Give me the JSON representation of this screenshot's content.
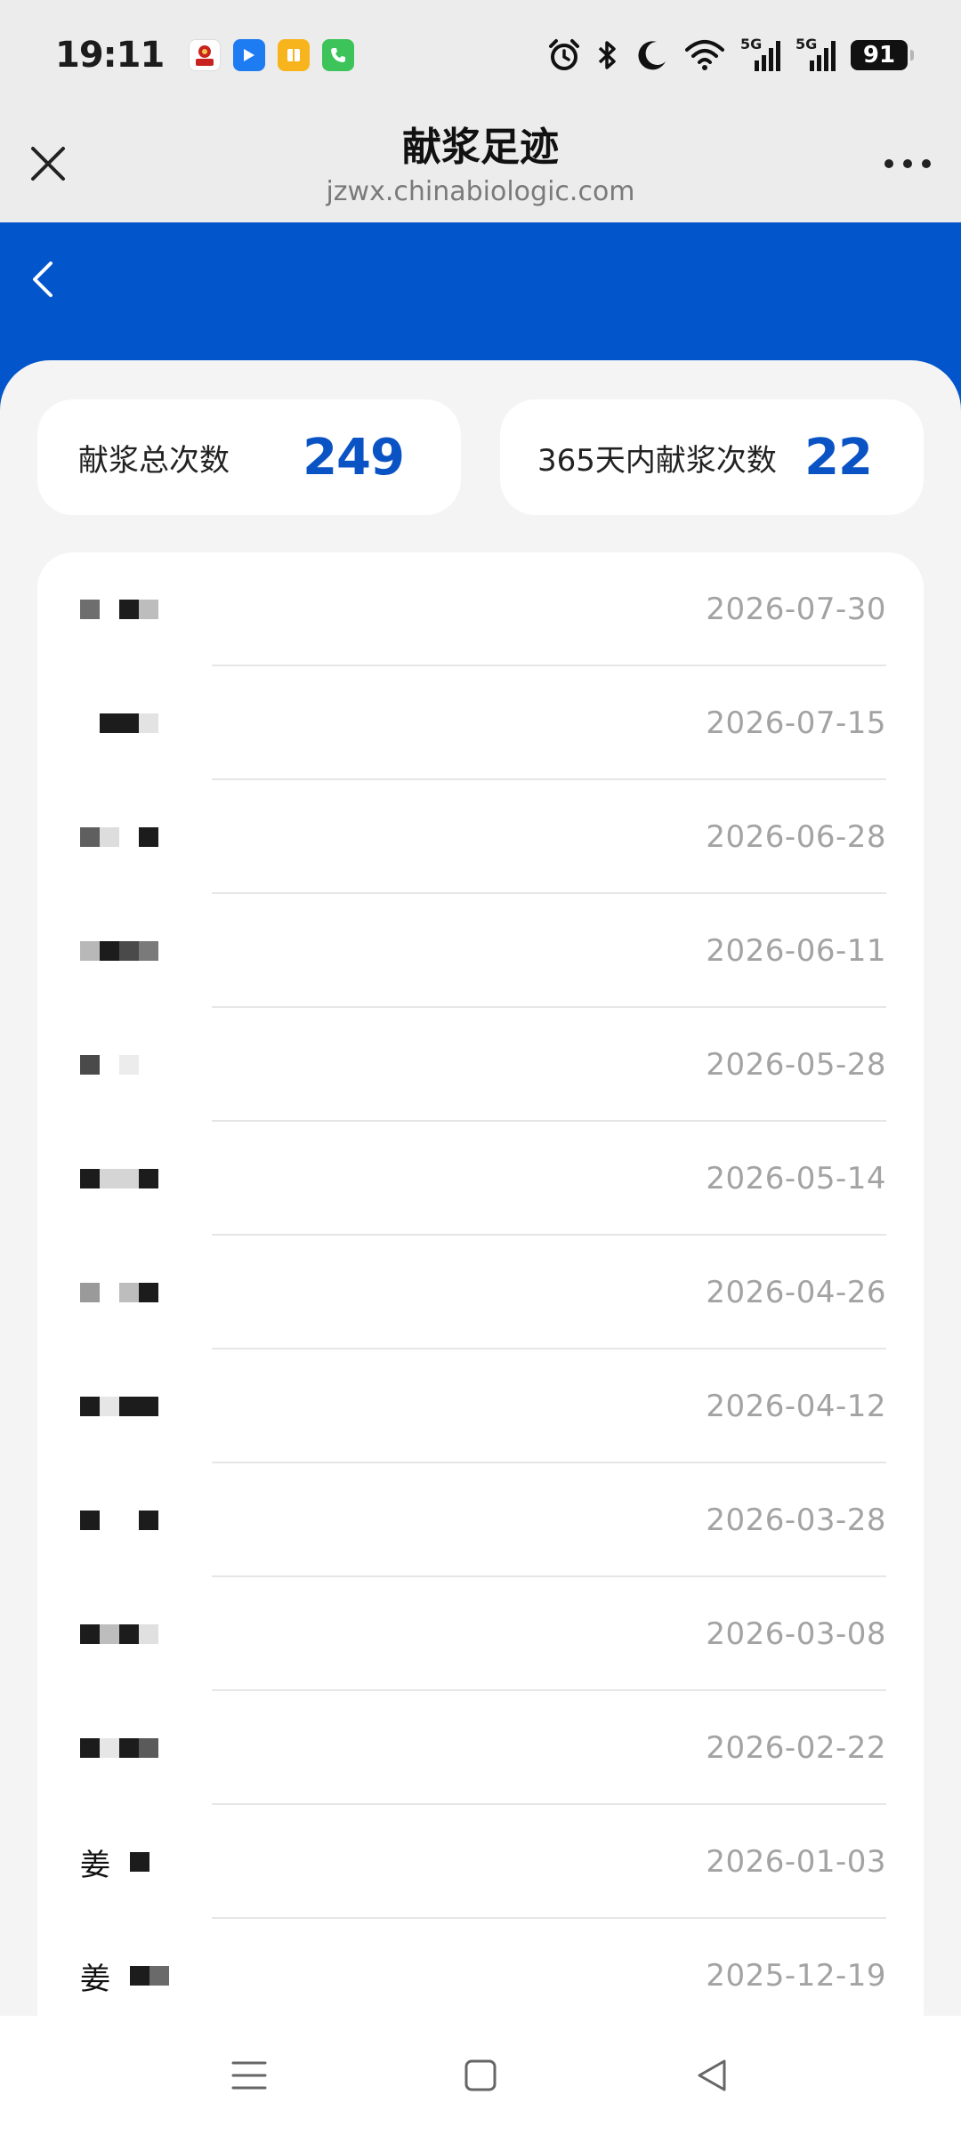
{
  "status_bar": {
    "time": "19:11",
    "battery": "91",
    "net1": "5G",
    "net2": "5G",
    "app_icons": [
      "red-app-icon",
      "blue-app-icon",
      "book-app-icon",
      "phone-app-icon"
    ],
    "status_icons": [
      "alarm-icon",
      "bluetooth-icon",
      "moon-icon",
      "wifi-icon",
      "signal-icon",
      "signal-icon"
    ]
  },
  "title_bar": {
    "title": "献浆足迹",
    "url": "jzwx.chinabiologic.com"
  },
  "colors": {
    "brand_blue": "#0355cb",
    "stat_blue": "#0a53c4",
    "date_gray": "#a3a3a3"
  },
  "stats": {
    "total_label": "献浆总次数",
    "total_value": "249",
    "year_label": "365天内献浆次数",
    "year_value": "22"
  },
  "records": [
    {
      "date": "2026-07-30"
    },
    {
      "date": "2026-07-15"
    },
    {
      "date": "2026-06-28"
    },
    {
      "date": "2026-06-11"
    },
    {
      "date": "2026-05-28"
    },
    {
      "date": "2026-05-14"
    },
    {
      "date": "2026-04-26"
    },
    {
      "date": "2026-04-12"
    },
    {
      "date": "2026-03-28"
    },
    {
      "date": "2026-03-08"
    },
    {
      "date": "2026-02-22"
    },
    {
      "date": "2026-01-03",
      "name_prefix": "姜"
    },
    {
      "date": "2025-12-19",
      "name_prefix": "姜"
    }
  ]
}
